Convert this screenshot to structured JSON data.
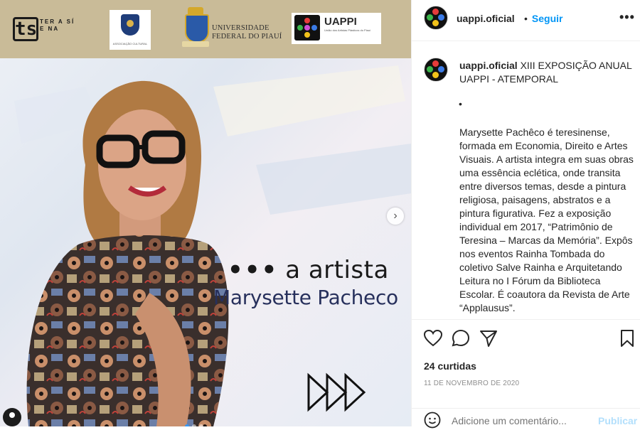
{
  "media": {
    "logos": {
      "ts_mark": "ts",
      "ts_text": "TER A SÍ E NA",
      "crest1_caption": "ASSOCIAÇÃO CULTURAL",
      "ufpi_line1": "UNIVERSIDADE",
      "ufpi_line2": "FEDERAL DO PIAUÍ",
      "uappi_title": "UAPPI",
      "uappi_sub": "União dos Artistas Plásticos do Piauí"
    },
    "dots": "•••",
    "headline": "a artista",
    "artist_name": "Marysette Pacheco",
    "next_arrow": "›"
  },
  "header": {
    "username": "uappi.oficial",
    "follow_label": "Seguir",
    "more_icon": "•••"
  },
  "caption": {
    "username": "uappi.oficial",
    "title": "XIII EXPOSIÇÃO ANUAL UAPPI - ATEMPORAL",
    "bullet": "•",
    "bio": "Marysette Pachêco é teresinense, formada em Economia, Direito e Artes Visuais. A artista integra em suas obras uma essência eclética, onde transita entre diversos temas, desde a pintura religiosa, paisagens, abstratos e a pintura figurativa. Fez a exposição individual em 2017, “Patrimônio de Teresina – Marcas da Memória”. Expôs nos eventos Rainha Tombada do coletivo Salve Rainha e Arquitetando Leitura no I Fórum da Biblioteca Escolar. É coautora da Revista de Arte “Applausus”."
  },
  "stats": {
    "likes": "24 curtidas",
    "date": "11 DE NOVEMBRO DE 2020"
  },
  "comment": {
    "placeholder": "Adicione um comentário...",
    "publish_label": "Publicar"
  },
  "colors": {
    "link_blue": "#0095f6",
    "publish_disabled": "#b2dffc",
    "artist_name": "#27305c",
    "logo_band": "#c9bb98"
  }
}
